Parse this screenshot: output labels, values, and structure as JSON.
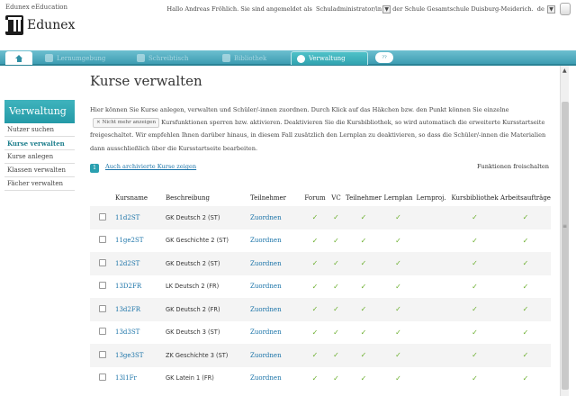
{
  "header": {
    "brand_small": "Edunex eEducation",
    "logo_text": "Edunex",
    "greeting": "Hallo Andreas Fröhlich. Sie sind angemeldet als",
    "role_value": "Schuladministrator/in",
    "school_text": "der Schule Gesamtschule Duisburg-Meiderich.",
    "lang_value": "de"
  },
  "nav": {
    "tabs": [
      {
        "label": "Lernumgebung"
      },
      {
        "label": "Schreibtisch"
      },
      {
        "label": "Bibliothek"
      },
      {
        "label": "Verwaltung"
      }
    ],
    "bubble": "??"
  },
  "sidebar": {
    "title": "Verwaltung",
    "items": [
      {
        "label": "Nutzer suchen"
      },
      {
        "label": "Kurse verwalten"
      },
      {
        "label": "Kurse anlegen"
      },
      {
        "label": "Klassen verwalten"
      },
      {
        "label": "Fächer verwalten"
      }
    ]
  },
  "main": {
    "title": "Kurse verwalten",
    "intro_1": "Hier können Sie Kurse anlegen, verwalten und Schüler/-innen zuordnen. Durch Klick auf das Häkchen bzw. den Punkt können Sie einzelne",
    "nomore": "× Nicht mehr anzeigen",
    "intro_2": "Kursfunktionen sperren bzw. aktivieren. Deaktivieren Sie die Kursbibliothek, so wird automatisch die erweiterte Kursstartseite freigeschaltet. Wir empfehlen Ihnen darüber hinaus, in diesem Fall zusätzlich den Lernplan zu deaktivieren, so dass die Schüler/-innen die Materialien dann ausschließlich über die Kursstartseite bearbeiten.",
    "step": "1",
    "archived_link": "Auch archivierte Kurse zeigen",
    "functions_label": "Funktionen freischalten"
  },
  "table": {
    "headers": {
      "kursname": "Kursname",
      "beschreibung": "Beschreibung",
      "teilnehmer": "Teilnehmer",
      "forum": "Forum",
      "vc": "VC",
      "teilnehmer2": "Teilnehmer",
      "lernplan": "Lernplan",
      "lernproj": "Lernproj.",
      "kursbib": "Kursbibliothek",
      "arbeitsauftraege": "Arbeitsaufträge"
    },
    "assign_label": "Zuordnen",
    "check_glyph": "✓",
    "rows": [
      {
        "name": "11d2ST",
        "desc": "GK Deutsch 2 (ST)"
      },
      {
        "name": "11ge2ST",
        "desc": "GK Geschichte 2 (ST)"
      },
      {
        "name": "12d2ST",
        "desc": "GK Deutsch 2 (ST)"
      },
      {
        "name": "13D2FR",
        "desc": "LK Deutsch 2 (FR)"
      },
      {
        "name": "13d2FR",
        "desc": "GK Deutsch 2 (FR)"
      },
      {
        "name": "13d3ST",
        "desc": "GK Deutsch 3 (ST)"
      },
      {
        "name": "13ge3ST",
        "desc": "ZK Geschichte 3 (ST)"
      },
      {
        "name": "13l1Fr",
        "desc": "GK Latein 1 (FR)"
      }
    ]
  }
}
